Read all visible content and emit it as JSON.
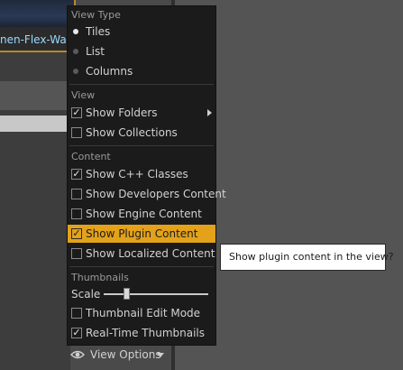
{
  "background": {
    "asset_label": "nen-Flex-Wate"
  },
  "menu": {
    "view_type": {
      "header": "View Type",
      "items": [
        {
          "label": "Tiles",
          "selected": true
        },
        {
          "label": "List",
          "selected": false
        },
        {
          "label": "Columns",
          "selected": false
        }
      ]
    },
    "view": {
      "header": "View",
      "items": [
        {
          "label": "Show Folders",
          "checked": true
        },
        {
          "label": "Show Collections",
          "checked": false
        }
      ]
    },
    "content": {
      "header": "Content",
      "items": [
        {
          "label": "Show C++ Classes",
          "checked": true
        },
        {
          "label": "Show Developers Content",
          "checked": false
        },
        {
          "label": "Show Engine Content",
          "checked": false
        },
        {
          "label": "Show Plugin Content",
          "checked": true,
          "highlighted": true
        },
        {
          "label": "Show Localized Content",
          "checked": false
        }
      ]
    },
    "thumbnails": {
      "header": "Thumbnails",
      "scale_label": "Scale",
      "scale_value": 0.2,
      "items": [
        {
          "label": "Thumbnail Edit Mode",
          "checked": false
        },
        {
          "label": "Real-Time Thumbnails",
          "checked": true
        }
      ]
    }
  },
  "view_options": {
    "label": "View Options",
    "icon": "eye-icon"
  },
  "tooltip": {
    "text": "Show plugin content in the view?"
  },
  "colors": {
    "highlight": "#e3a21a",
    "menu_bg": "#1b1b1b",
    "asset_label": "#9ad9ff"
  }
}
